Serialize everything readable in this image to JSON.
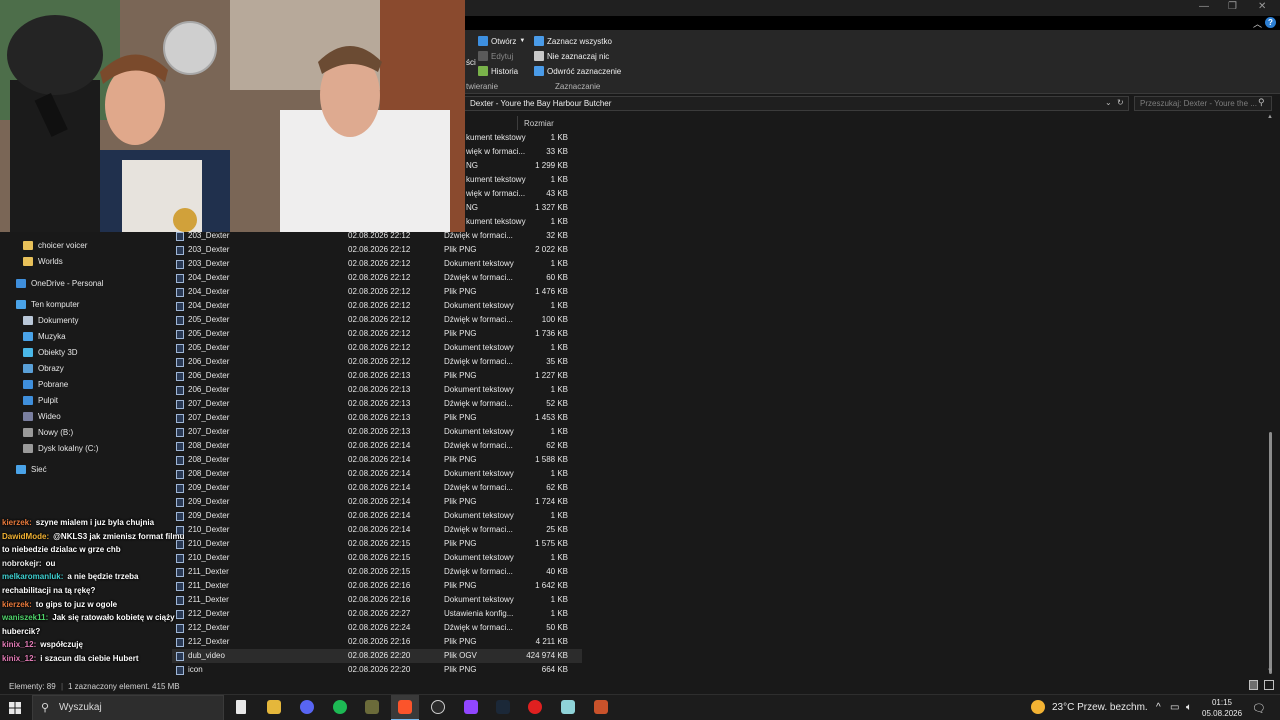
{
  "ribbon": {
    "open_label": "Otwórz",
    "edit_label": "Edytuj",
    "history_label": "Historia",
    "select_all_label": "Zaznacz wszystko",
    "select_none_label": "Nie zaznaczaj nic",
    "invert_label": "Odwróć zaznaczenie",
    "group_left_label": "twieranie",
    "group_select_label": "Zaznaczanie",
    "cut_label": "ści"
  },
  "address": {
    "path": "Dexter - Youre the Bay Harbour Butcher",
    "search_placeholder": "Przeszukaj: Dexter - Youre the ..."
  },
  "columns": {
    "size": "Rozmiar"
  },
  "partial_rows": [
    {
      "type": "kument tekstowy",
      "size": "1 KB"
    },
    {
      "type": "więk w formaci...",
      "size": "33 KB"
    },
    {
      "type": "NG",
      "size": "1 299 KB"
    },
    {
      "type": "kument tekstowy",
      "size": "1 KB"
    },
    {
      "type": "więk w formaci...",
      "size": "43 KB"
    },
    {
      "type": "NG",
      "size": "1 327 KB"
    },
    {
      "type": "kument tekstowy",
      "size": "1 KB"
    }
  ],
  "files": [
    {
      "name": "203_Dexter",
      "date": "02.08.2026 22:12",
      "type": "Dźwięk w formaci...",
      "size": "32 KB"
    },
    {
      "name": "203_Dexter",
      "date": "02.08.2026 22:12",
      "type": "Plik PNG",
      "size": "2 022 KB"
    },
    {
      "name": "203_Dexter",
      "date": "02.08.2026 22:12",
      "type": "Dokument tekstowy",
      "size": "1 KB"
    },
    {
      "name": "204_Dexter",
      "date": "02.08.2026 22:12",
      "type": "Dźwięk w formaci...",
      "size": "60 KB"
    },
    {
      "name": "204_Dexter",
      "date": "02.08.2026 22:12",
      "type": "Plik PNG",
      "size": "1 476 KB"
    },
    {
      "name": "204_Dexter",
      "date": "02.08.2026 22:12",
      "type": "Dokument tekstowy",
      "size": "1 KB"
    },
    {
      "name": "205_Dexter",
      "date": "02.08.2026 22:12",
      "type": "Dźwięk w formaci...",
      "size": "100 KB"
    },
    {
      "name": "205_Dexter",
      "date": "02.08.2026 22:12",
      "type": "Plik PNG",
      "size": "1 736 KB"
    },
    {
      "name": "205_Dexter",
      "date": "02.08.2026 22:12",
      "type": "Dokument tekstowy",
      "size": "1 KB"
    },
    {
      "name": "206_Dexter",
      "date": "02.08.2026 22:12",
      "type": "Dźwięk w formaci...",
      "size": "35 KB"
    },
    {
      "name": "206_Dexter",
      "date": "02.08.2026 22:13",
      "type": "Plik PNG",
      "size": "1 227 KB"
    },
    {
      "name": "206_Dexter",
      "date": "02.08.2026 22:13",
      "type": "Dokument tekstowy",
      "size": "1 KB"
    },
    {
      "name": "207_Dexter",
      "date": "02.08.2026 22:13",
      "type": "Dźwięk w formaci...",
      "size": "52 KB"
    },
    {
      "name": "207_Dexter",
      "date": "02.08.2026 22:13",
      "type": "Plik PNG",
      "size": "1 453 KB"
    },
    {
      "name": "207_Dexter",
      "date": "02.08.2026 22:13",
      "type": "Dokument tekstowy",
      "size": "1 KB"
    },
    {
      "name": "208_Dexter",
      "date": "02.08.2026 22:14",
      "type": "Dźwięk w formaci...",
      "size": "62 KB"
    },
    {
      "name": "208_Dexter",
      "date": "02.08.2026 22:14",
      "type": "Plik PNG",
      "size": "1 588 KB"
    },
    {
      "name": "208_Dexter",
      "date": "02.08.2026 22:14",
      "type": "Dokument tekstowy",
      "size": "1 KB"
    },
    {
      "name": "209_Dexter",
      "date": "02.08.2026 22:14",
      "type": "Dźwięk w formaci...",
      "size": "62 KB"
    },
    {
      "name": "209_Dexter",
      "date": "02.08.2026 22:14",
      "type": "Plik PNG",
      "size": "1 724 KB"
    },
    {
      "name": "209_Dexter",
      "date": "02.08.2026 22:14",
      "type": "Dokument tekstowy",
      "size": "1 KB"
    },
    {
      "name": "210_Dexter",
      "date": "02.08.2026 22:14",
      "type": "Dźwięk w formaci...",
      "size": "25 KB"
    },
    {
      "name": "210_Dexter",
      "date": "02.08.2026 22:15",
      "type": "Plik PNG",
      "size": "1 575 KB"
    },
    {
      "name": "210_Dexter",
      "date": "02.08.2026 22:15",
      "type": "Dokument tekstowy",
      "size": "1 KB"
    },
    {
      "name": "211_Dexter",
      "date": "02.08.2026 22:15",
      "type": "Dźwięk w formaci...",
      "size": "40 KB"
    },
    {
      "name": "211_Dexter",
      "date": "02.08.2026 22:16",
      "type": "Plik PNG",
      "size": "1 642 KB"
    },
    {
      "name": "211_Dexter",
      "date": "02.08.2026 22:16",
      "type": "Dokument tekstowy",
      "size": "1 KB"
    },
    {
      "name": "212_Dexter",
      "date": "02.08.2026 22:27",
      "type": "Ustawienia konfig...",
      "size": "1 KB"
    },
    {
      "name": "212_Dexter",
      "date": "02.08.2026 22:24",
      "type": "Dźwięk w formaci...",
      "size": "50 KB"
    },
    {
      "name": "212_Dexter",
      "date": "02.08.2026 22:16",
      "type": "Plik PNG",
      "size": "4 211 KB"
    },
    {
      "name": "dub_video",
      "date": "02.08.2026 22:20",
      "type": "Plik OGV",
      "size": "424 974 KB"
    },
    {
      "name": "icon",
      "date": "02.08.2026 22:20",
      "type": "Plik PNG",
      "size": "664 KB"
    }
  ],
  "nav": {
    "items": [
      {
        "label": "choicer voicer",
        "icon": "folder-icon"
      },
      {
        "label": "Worlds",
        "icon": "folder-icon"
      },
      {
        "label": "OneDrive - Personal",
        "icon": "cloud-icon"
      },
      {
        "label": "Ten komputer",
        "icon": "computer-icon"
      },
      {
        "label": "Dokumenty",
        "icon": "documents-icon"
      },
      {
        "label": "Muzyka",
        "icon": "music-icon"
      },
      {
        "label": "Obiekty 3D",
        "icon": "cube-icon"
      },
      {
        "label": "Obrazy",
        "icon": "pictures-icon"
      },
      {
        "label": "Pobrane",
        "icon": "download-icon"
      },
      {
        "label": "Pulpit",
        "icon": "desktop-icon"
      },
      {
        "label": "Wideo",
        "icon": "video-icon"
      },
      {
        "label": "Nowy (B:)",
        "icon": "drive-icon"
      },
      {
        "label": "Dysk lokalny (C:)",
        "icon": "drive-icon"
      },
      {
        "label": "Sieć",
        "icon": "network-icon"
      }
    ]
  },
  "chat": [
    {
      "user": "kierzek:",
      "color": "#e87a3c",
      "text": "szyne mialem i juz byla chujnia"
    },
    {
      "user": "DawidMode:",
      "color": "#f2b233",
      "text": "@NKLS3 jak zmienisz format filmu to niebedzie dzialac w grze chb"
    },
    {
      "user": "nobrokejr:",
      "color": "#e8e8e8",
      "text": "ou"
    },
    {
      "user": "melkaromanluk:",
      "color": "#3fd0d0",
      "text": "a nie będzie trzeba rechabilitacji na tą rękę?"
    },
    {
      "user": "kierzek:",
      "color": "#e87a3c",
      "text": "to gips to juz w ogole"
    },
    {
      "user": "waniszek11:",
      "color": "#4fd36a",
      "text": "Jak się ratowało kobietę w ciąży hubercik?"
    },
    {
      "user": "kinix_12:",
      "color": "#e27ab5",
      "text": "współczuję"
    },
    {
      "user": "kinix_12:",
      "color": "#e27ab5",
      "text": "i szacun dla ciebie Hubert"
    }
  ],
  "status": {
    "elements": "Elementy: 89",
    "selected": "1 zaznaczony element. 415 MB"
  },
  "taskbar": {
    "search_label": "Wyszukaj",
    "weather": "23°C  Przew. bezchm.",
    "time": "01:15",
    "date": "05.08.2026"
  }
}
